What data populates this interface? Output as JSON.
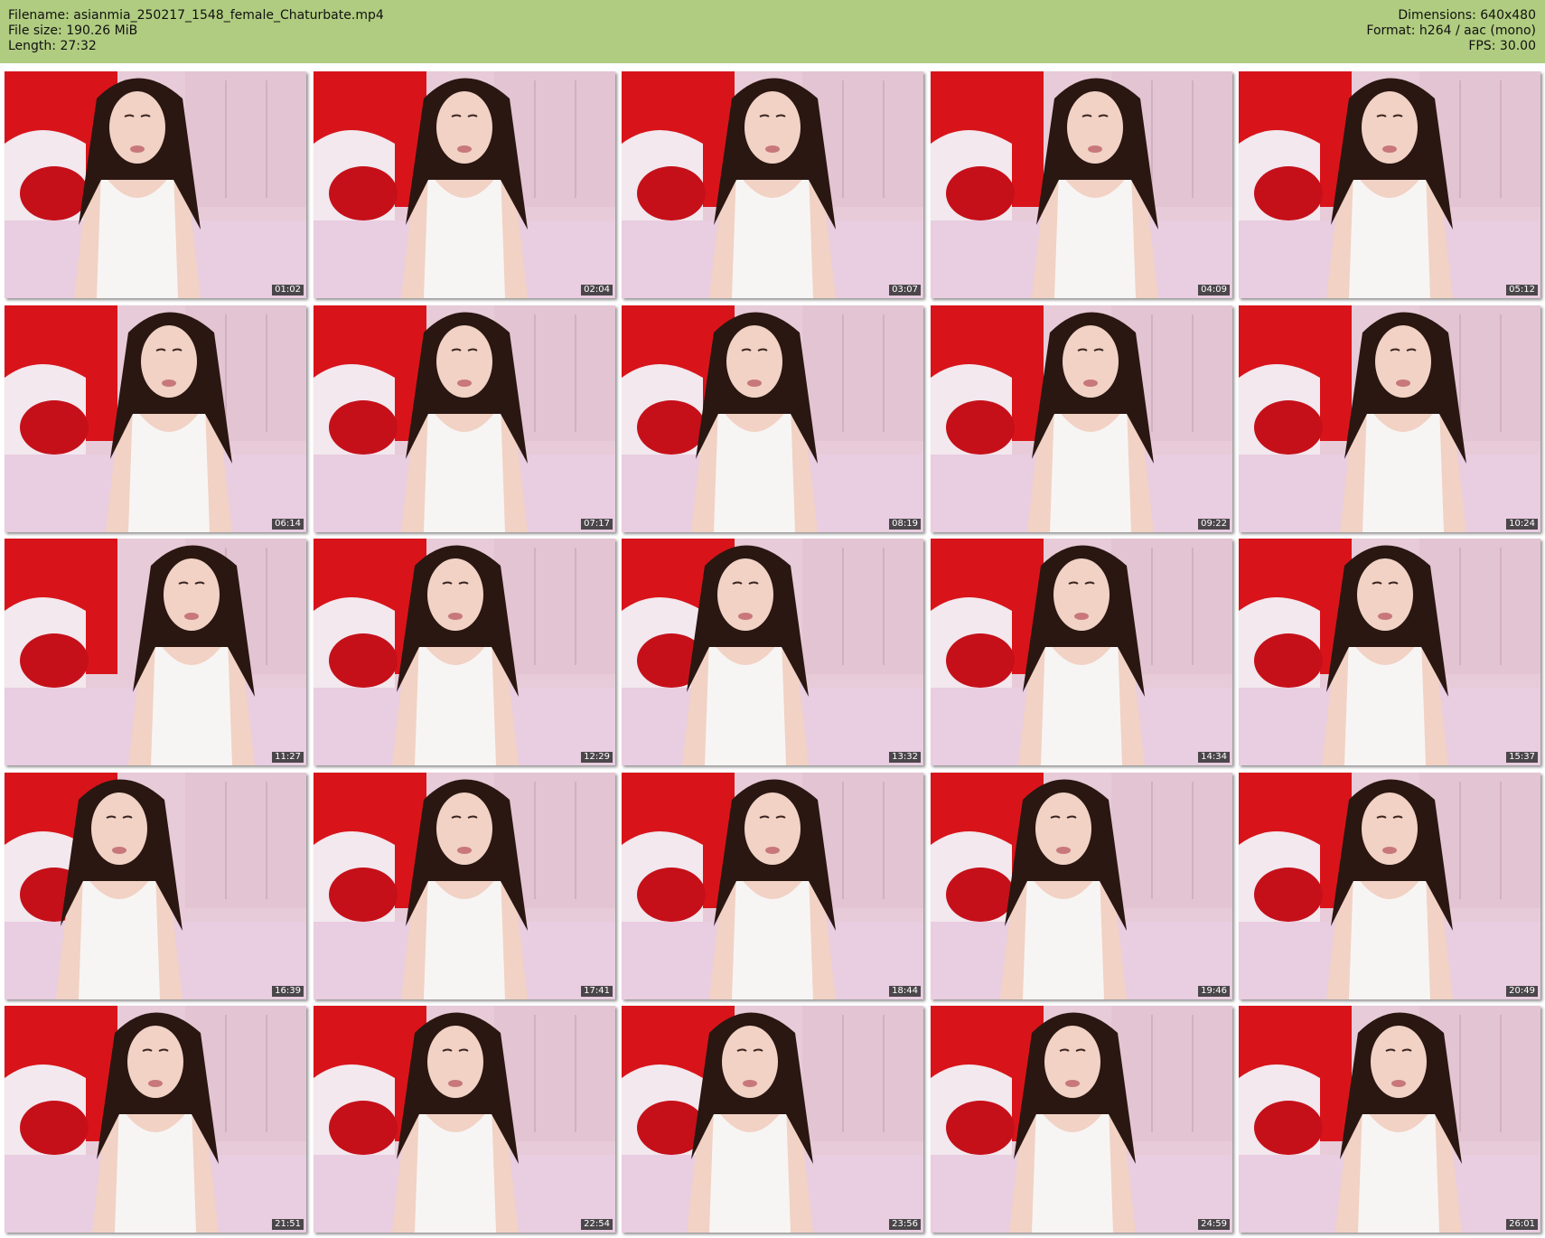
{
  "header": {
    "filename_line": "Filename: asianmia_250217_1548_female_Chaturbate.mp4",
    "filesize_line": "File size: 190.26 MiB",
    "length_line": "Length: 27:32",
    "dimensions_line": "Dimensions: 640x480",
    "format_line": "Format: h264 / aac (mono)",
    "fps_line": "FPS: 30.00"
  },
  "colors": {
    "header_bg": "#b0cc80",
    "wall_red": "#d8141a",
    "wall_pink": "#e8cbd8",
    "bed_pink": "#e9cde0",
    "top_white": "#f7f5f4",
    "hair": "#2a1712",
    "skin": "#f1d2c4"
  },
  "thumbnails": [
    {
      "timestamp": "01:02"
    },
    {
      "timestamp": "02:04"
    },
    {
      "timestamp": "03:07"
    },
    {
      "timestamp": "04:09"
    },
    {
      "timestamp": "05:12"
    },
    {
      "timestamp": "06:14"
    },
    {
      "timestamp": "07:17"
    },
    {
      "timestamp": "08:19"
    },
    {
      "timestamp": "09:22"
    },
    {
      "timestamp": "10:24"
    },
    {
      "timestamp": "11:27"
    },
    {
      "timestamp": "12:29"
    },
    {
      "timestamp": "13:32"
    },
    {
      "timestamp": "14:34"
    },
    {
      "timestamp": "15:37"
    },
    {
      "timestamp": "16:39"
    },
    {
      "timestamp": "17:41"
    },
    {
      "timestamp": "18:44"
    },
    {
      "timestamp": "19:46"
    },
    {
      "timestamp": "20:49"
    },
    {
      "timestamp": "21:51"
    },
    {
      "timestamp": "22:54"
    },
    {
      "timestamp": "23:56"
    },
    {
      "timestamp": "24:59"
    },
    {
      "timestamp": "26:01"
    }
  ]
}
